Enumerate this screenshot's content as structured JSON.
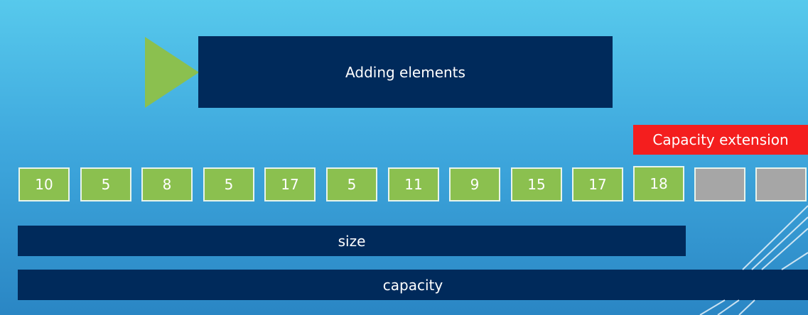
{
  "title": "Adding elements",
  "capacity_extension_label": "Capacity extension",
  "elements": [
    "10",
    "5",
    "8",
    "5",
    "17",
    "5",
    "11",
    "9",
    "15",
    "17",
    "18"
  ],
  "empty_slots": 2,
  "size_label": "size",
  "capacity_label": "capacity",
  "colors": {
    "title_box": "#002a5b",
    "element_fill": "#8bc04f",
    "empty_fill": "#a6a6a6",
    "extension_fill": "#f41e1e",
    "bar_fill": "#002a5b"
  }
}
